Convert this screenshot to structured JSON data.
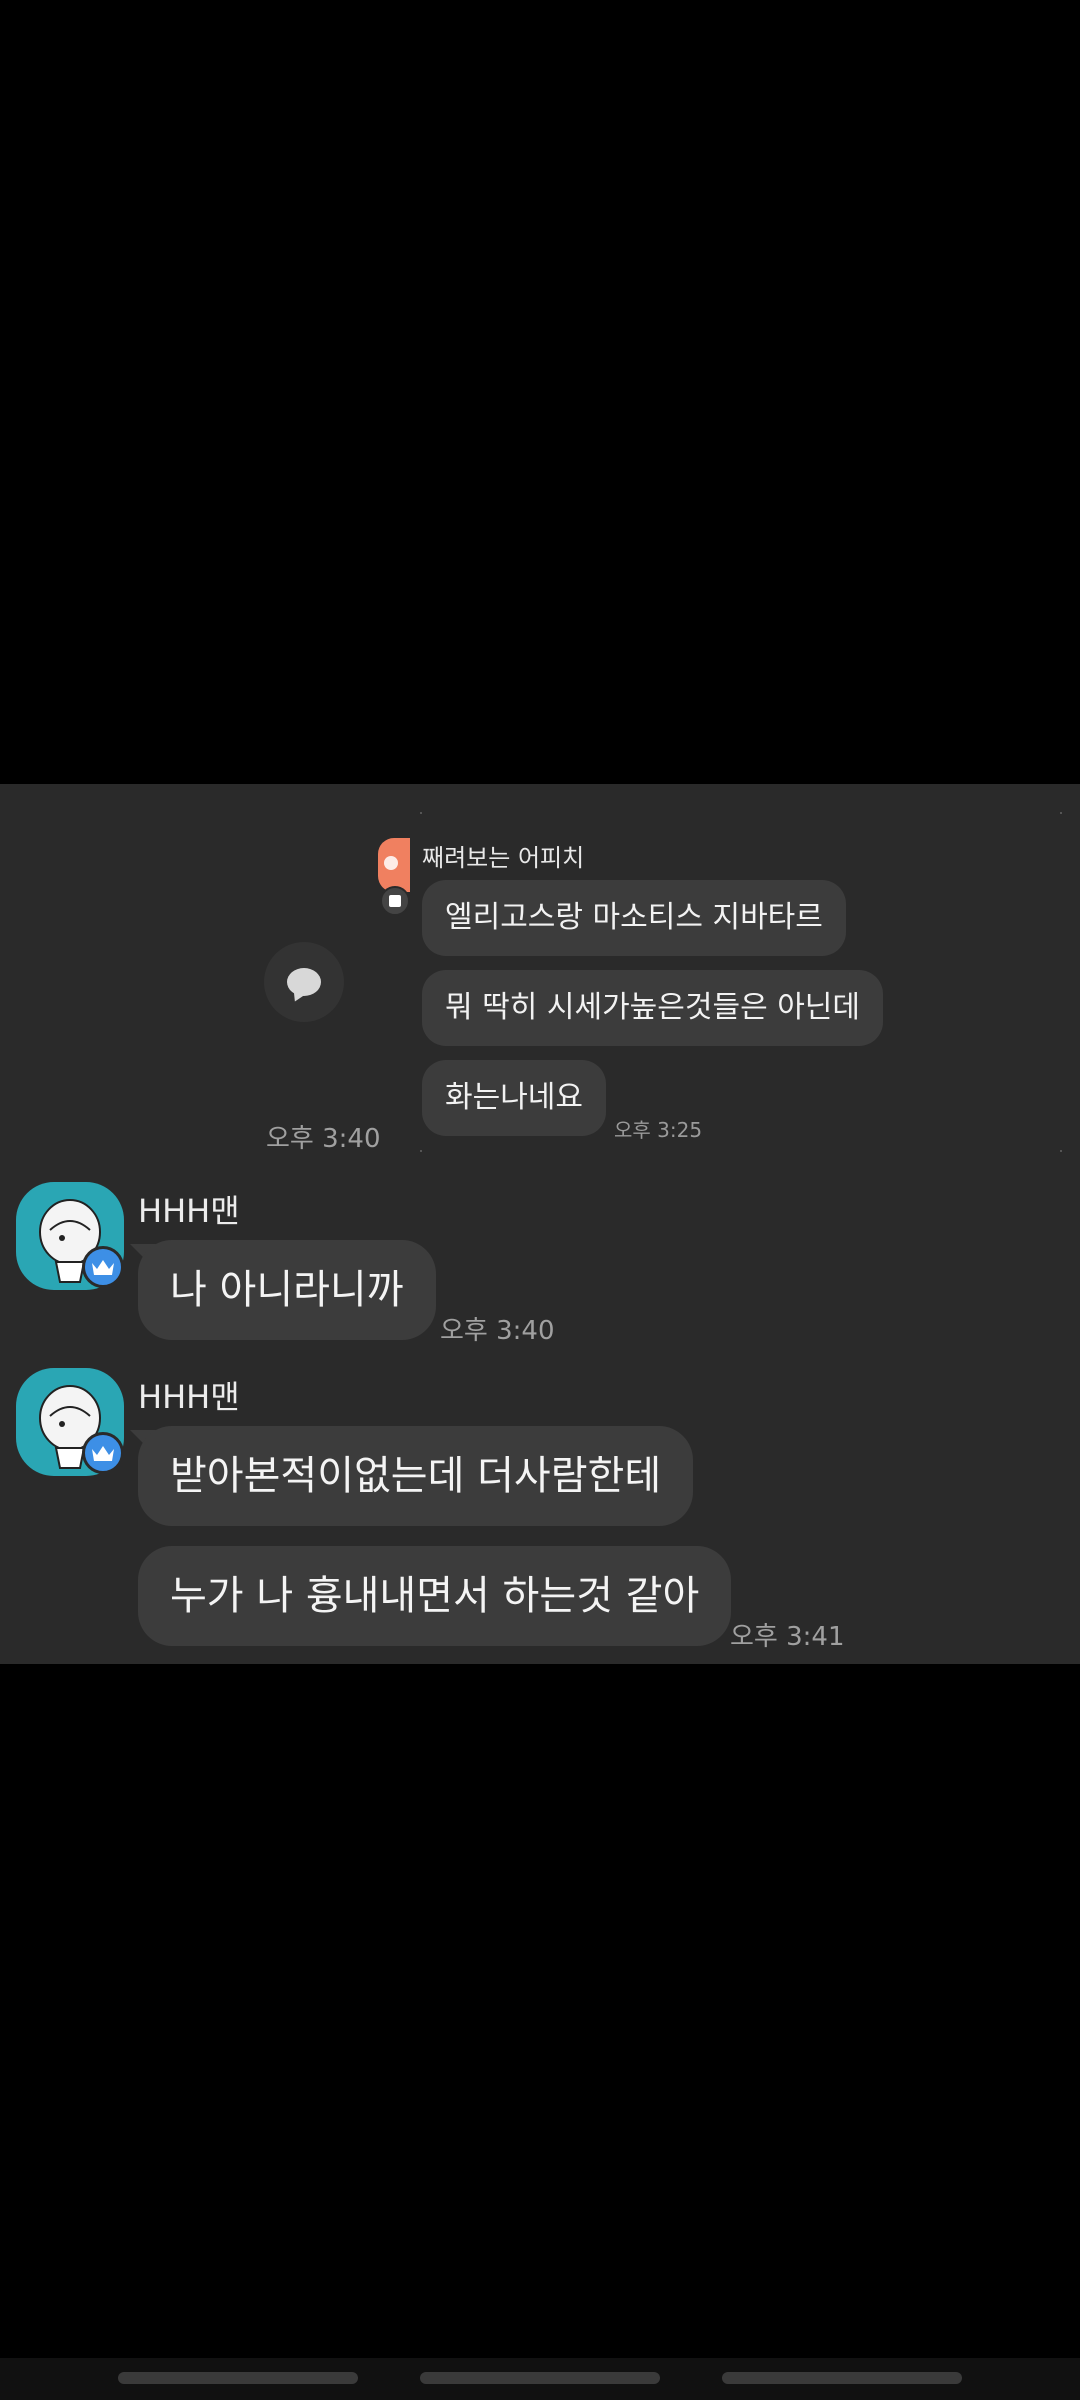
{
  "shared_card": {
    "sender": "째려보는 어피치",
    "messages": [
      "엘리고스랑 마소티스 지바타르",
      "뭐 딱히 시세가높은것들은 아닌데",
      "화는나네요"
    ],
    "time": "오후 3:25"
  },
  "shared_time": "오후 3:40",
  "groups": [
    {
      "sender": "HHH맨",
      "messages": [
        "나 아니라니까"
      ],
      "time": "오후 3:40"
    },
    {
      "sender": "HHH맨",
      "messages": [
        "받아본적이없는데 더사람한테",
        "누가 나 흉내내면서 하는것 같아"
      ],
      "time": "오후 3:41"
    }
  ],
  "colors": {
    "background": "#000000",
    "chat_background": "#2a2a2a",
    "bubble": "#3c3c3c",
    "avatar": "#2aa6b4",
    "crown_badge": "#3d8fe6",
    "mini_avatar": "#f08060"
  }
}
